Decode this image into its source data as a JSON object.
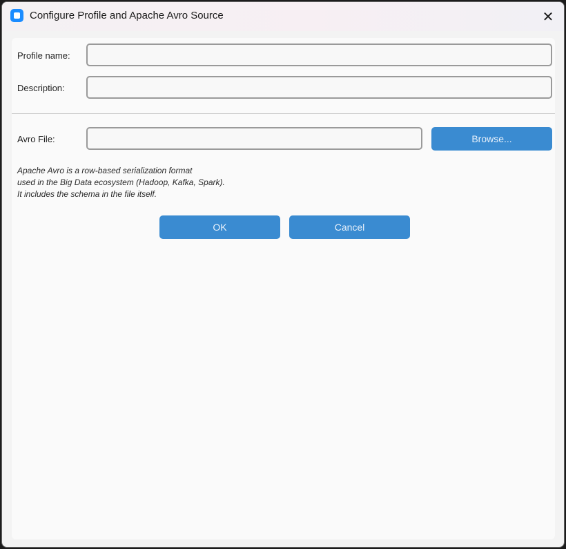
{
  "window": {
    "title": "Configure Profile and Apache Avro Source",
    "close_glyph": "✕"
  },
  "form": {
    "profile_name_label": "Profile name:",
    "profile_name_value": "",
    "description_label": "Description:",
    "description_value": "",
    "avro_file_label": "Avro File:",
    "avro_file_value": "",
    "browse_label": "Browse..."
  },
  "help": {
    "lines": [
      "Apache Avro is a row-based serialization format",
      "used in the Big Data ecosystem (Hadoop, Kafka, Spark).",
      "It includes the schema in the file itself."
    ]
  },
  "actions": {
    "ok_label": "OK",
    "cancel_label": "Cancel"
  },
  "colors": {
    "accent": "#3a8bd1",
    "app_icon": "#1a8cff"
  },
  "icons": {
    "app": "app-icon",
    "close": "close-icon"
  }
}
